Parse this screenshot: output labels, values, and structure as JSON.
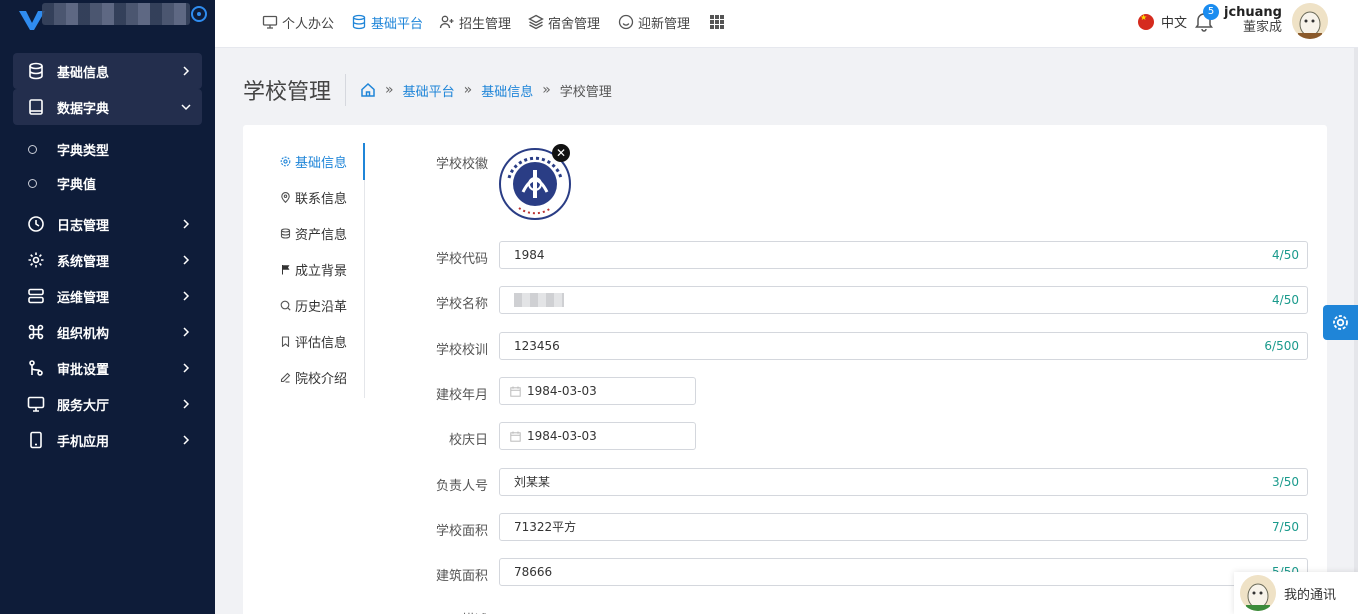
{
  "sidebar": {
    "items": [
      {
        "label": "基础信息",
        "icon": "database-icon"
      },
      {
        "label": "数据字典",
        "icon": "book-icon"
      },
      {
        "label": "日志管理",
        "icon": "clock-icon"
      },
      {
        "label": "系统管理",
        "icon": "gear-icon"
      },
      {
        "label": "运维管理",
        "icon": "server-icon"
      },
      {
        "label": "组织机构",
        "icon": "command-icon"
      },
      {
        "label": "审批设置",
        "icon": "git-branch-icon"
      },
      {
        "label": "服务大厅",
        "icon": "monitor-icon"
      },
      {
        "label": "手机应用",
        "icon": "phone-icon"
      }
    ],
    "sub_items": [
      {
        "label": "字典类型"
      },
      {
        "label": "字典值"
      }
    ]
  },
  "topnav": {
    "items": [
      {
        "label": "个人办公"
      },
      {
        "label": "基础平台"
      },
      {
        "label": "招生管理"
      },
      {
        "label": "宿舍管理"
      },
      {
        "label": "迎新管理"
      }
    ],
    "lang": "中文",
    "badge": "5",
    "username": "jchuang",
    "display_name": "董家成"
  },
  "page": {
    "title": "学校管理",
    "breadcrumb": [
      "基础平台",
      "基础信息",
      "学校管理"
    ]
  },
  "anchors": [
    {
      "label": "基础信息"
    },
    {
      "label": "联系信息"
    },
    {
      "label": "资产信息"
    },
    {
      "label": "成立背景"
    },
    {
      "label": "历史沿革"
    },
    {
      "label": "评估信息"
    },
    {
      "label": "院校介绍"
    }
  ],
  "form": {
    "logo_label": "学校校徽",
    "code": {
      "label": "学校代码",
      "value": "1984",
      "count": "4/50"
    },
    "name": {
      "label": "学校名称",
      "count": "4/50"
    },
    "motto": {
      "label": "学校校训",
      "value": "123456",
      "count": "6/500"
    },
    "founded": {
      "label": "建校年月",
      "value": "1984-03-03"
    },
    "anniversary": {
      "label": "校庆日",
      "value": "1984-03-03"
    },
    "leader": {
      "label": "负责人号",
      "value": "刘某某",
      "count": "3/50"
    },
    "area": {
      "label": "学校面积",
      "value": "71322平方",
      "count": "7/50"
    },
    "building_area": {
      "label": "建筑面积",
      "value": "78666",
      "count": "5/50"
    },
    "desc_label": "描述"
  },
  "notice": {
    "label": "我的通讯"
  },
  "colors": {
    "sidebar": "#0e1c39",
    "accent": "#1f85d8",
    "counter": "#1a9a8c"
  }
}
